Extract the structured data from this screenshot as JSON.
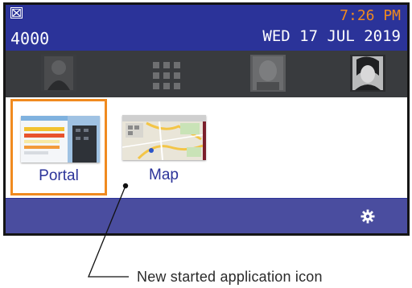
{
  "status_bar": {
    "system_icon": "envelope-icon",
    "extension": "4000",
    "time": "7:26 PM",
    "date": "WED 17 JUL 2019",
    "colors": {
      "background": "#2b3399",
      "time": "#f08a1f",
      "text": "#ffffff"
    }
  },
  "favorites_bar": {
    "items": [
      {
        "icon": "contact-photo-icon"
      },
      {
        "icon": "apps-grid-icon"
      },
      {
        "icon": "contact-photo-icon"
      },
      {
        "icon": "contact-photo-icon"
      }
    ],
    "background": "#393b3e"
  },
  "apps": [
    {
      "label": "Portal",
      "selected": true,
      "icon": "portal-thumbnail"
    },
    {
      "label": "Map",
      "selected": false,
      "icon": "map-thumbnail"
    }
  ],
  "bottom_bar": {
    "settings_icon": "gear-icon",
    "background": "#4a4d9f"
  },
  "annotation": {
    "caption": "New started application icon"
  },
  "accent": "#f08a1f"
}
